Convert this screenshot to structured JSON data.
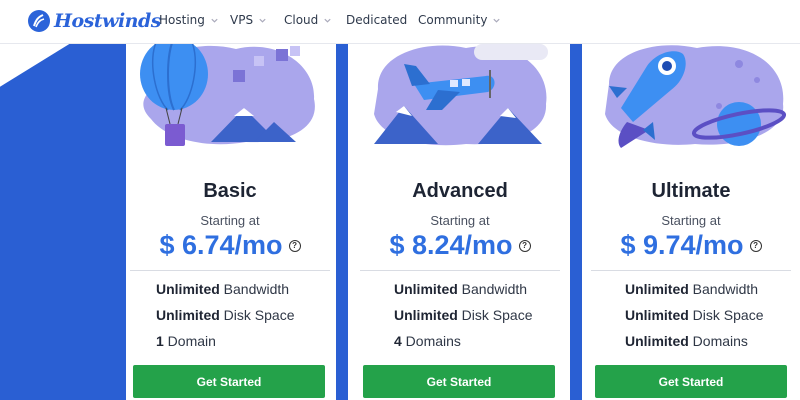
{
  "brand": {
    "name": "Hostwinds",
    "color": "#2b63d9"
  },
  "nav": {
    "items": [
      {
        "label": "Hosting",
        "dropdown": true
      },
      {
        "label": "VPS",
        "dropdown": true
      },
      {
        "label": "Cloud",
        "dropdown": true
      },
      {
        "label": "Dedicated",
        "dropdown": false
      },
      {
        "label": "Community",
        "dropdown": true
      }
    ]
  },
  "colors": {
    "background_blue": "#2a5fd3",
    "price": "#2f6fe0",
    "cta": "#24a24a",
    "illustration_purple": "#9b97e6"
  },
  "plans": [
    {
      "name": "Basic",
      "starting_label": "Starting at",
      "price": "$ 6.74/mo",
      "features": [
        {
          "bold": "Unlimited",
          "text": " Bandwidth"
        },
        {
          "bold": "Unlimited",
          "text": " Disk Space"
        },
        {
          "bold": "1",
          "text": " Domain"
        }
      ],
      "cta": "Get Started",
      "illustration": "hot-air-balloon"
    },
    {
      "name": "Advanced",
      "starting_label": "Starting at",
      "price": "$ 8.24/mo",
      "features": [
        {
          "bold": "Unlimited",
          "text": " Bandwidth"
        },
        {
          "bold": "Unlimited",
          "text": " Disk Space"
        },
        {
          "bold": "4",
          "text": " Domains"
        }
      ],
      "cta": "Get Started",
      "illustration": "airplane"
    },
    {
      "name": "Ultimate",
      "starting_label": "Starting at",
      "price": "$ 9.74/mo",
      "features": [
        {
          "bold": "Unlimited",
          "text": " Bandwidth"
        },
        {
          "bold": "Unlimited",
          "text": " Disk Space"
        },
        {
          "bold": "Unlimited",
          "text": " Domains"
        }
      ],
      "cta": "Get Started",
      "illustration": "rocket"
    }
  ]
}
